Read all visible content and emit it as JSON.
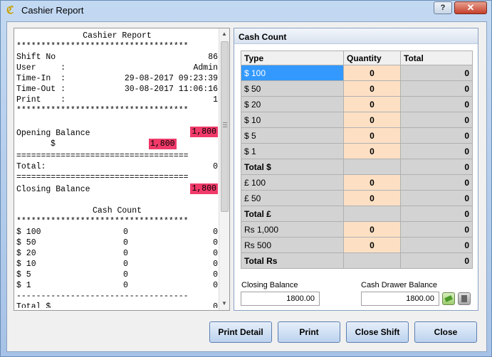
{
  "window": {
    "title": "Cashier Report",
    "help_label": "?",
    "close_label": "✕"
  },
  "receipt": {
    "title": "Cashier Report",
    "stars": "***********************************",
    "shift_label": "Shift No",
    "shift_value": "86",
    "user_label": "User     :",
    "user_value": "Admin",
    "timein_label": "Time-In  :",
    "timein_value": "29-08-2017 09:23:39",
    "timeout_label": "Time-Out :",
    "timeout_value": "30-08-2017 11:06:16",
    "print_label": "Print    :",
    "print_value": "1",
    "opening_label": "Opening Balance",
    "opening_value": "1,800",
    "opening_cur": "$",
    "opening_cur_value": "1,800",
    "equals": "===================================",
    "total_label": "Total:",
    "total_value": "0",
    "closing_label": "Closing Balance",
    "closing_value": "1,800",
    "cashcount_title": "Cash Count",
    "rows": [
      {
        "type": "$ 100",
        "qty": "0",
        "total": "0"
      },
      {
        "type": "$ 50",
        "qty": "0",
        "total": "0"
      },
      {
        "type": "$ 20",
        "qty": "0",
        "total": "0"
      },
      {
        "type": "$ 10",
        "qty": "0",
        "total": "0"
      },
      {
        "type": "$ 5",
        "qty": "0",
        "total": "0"
      },
      {
        "type": "$ 1",
        "qty": "0",
        "total": "0"
      }
    ],
    "dashes": "-----------------------------------",
    "total_cur_label": "Total $",
    "total_cur_value": "0"
  },
  "cash_count": {
    "header": "Cash Count",
    "columns": [
      "Type",
      "Quantity",
      "Total"
    ],
    "rows": [
      {
        "type": "$ 100",
        "qty": "0",
        "total": "0"
      },
      {
        "type": "$ 50",
        "qty": "0",
        "total": "0"
      },
      {
        "type": "$ 20",
        "qty": "0",
        "total": "0"
      },
      {
        "type": "$ 10",
        "qty": "0",
        "total": "0"
      },
      {
        "type": "$ 5",
        "qty": "0",
        "total": "0"
      },
      {
        "type": "$ 1",
        "qty": "0",
        "total": "0"
      },
      {
        "type": "Total $",
        "qty": "",
        "total": "0"
      },
      {
        "type": "£ 100",
        "qty": "0",
        "total": "0"
      },
      {
        "type": "£ 50",
        "qty": "0",
        "total": "0"
      },
      {
        "type": "Total £",
        "qty": "",
        "total": "0"
      },
      {
        "type": "Rs 1,000",
        "qty": "0",
        "total": "0"
      },
      {
        "type": "Rs 500",
        "qty": "0",
        "total": "0"
      },
      {
        "type": "Total Rs",
        "qty": "",
        "total": "0"
      }
    ],
    "closing_balance_label": "Closing Balance",
    "closing_balance_value": "1800.00",
    "drawer_balance_label": "Cash Drawer Balance",
    "drawer_balance_value": "1800.00"
  },
  "buttons": {
    "print_detail": "Print Detail",
    "print": "Print",
    "close_shift": "Close Shift",
    "close": "Close"
  }
}
